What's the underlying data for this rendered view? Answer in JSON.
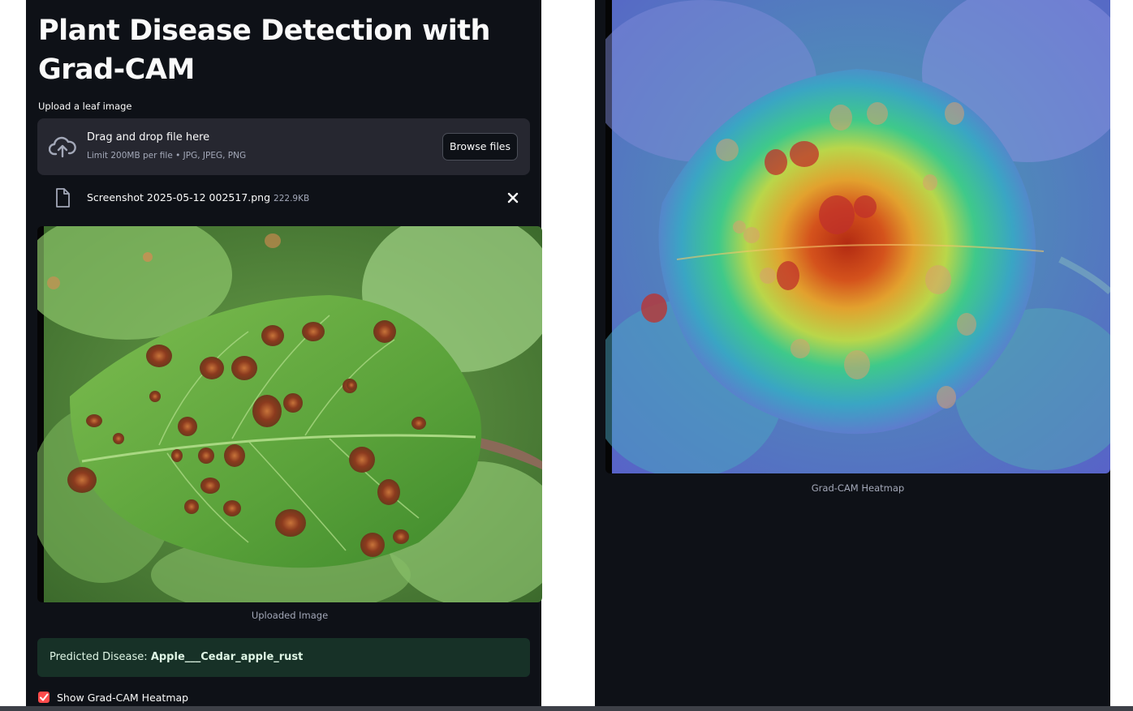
{
  "app": {
    "title": "Plant Disease Detection with Grad-CAM"
  },
  "uploader": {
    "label": "Upload a leaf image",
    "drop_text": "Drag and drop file here",
    "limit_text": "Limit 200MB per file • JPG, JPEG, PNG",
    "browse_label": "Browse files",
    "file": {
      "name": "Screenshot 2025-05-12 002517.png",
      "size": "222.9KB"
    }
  },
  "uploaded_image": {
    "caption": "Uploaded Image"
  },
  "prediction": {
    "label": "Predicted Disease:",
    "value": "Apple___Cedar_apple_rust"
  },
  "heatmap_toggle": {
    "label": "Show Grad-CAM Heatmap",
    "checked": true
  },
  "heatmap": {
    "caption": "Grad-CAM Heatmap"
  },
  "colors": {
    "background": "#0e1117",
    "dropzone": "#262730",
    "success_bg": "#173127",
    "accent": "#ff4b4b",
    "muted_text": "#a3a8b8"
  }
}
